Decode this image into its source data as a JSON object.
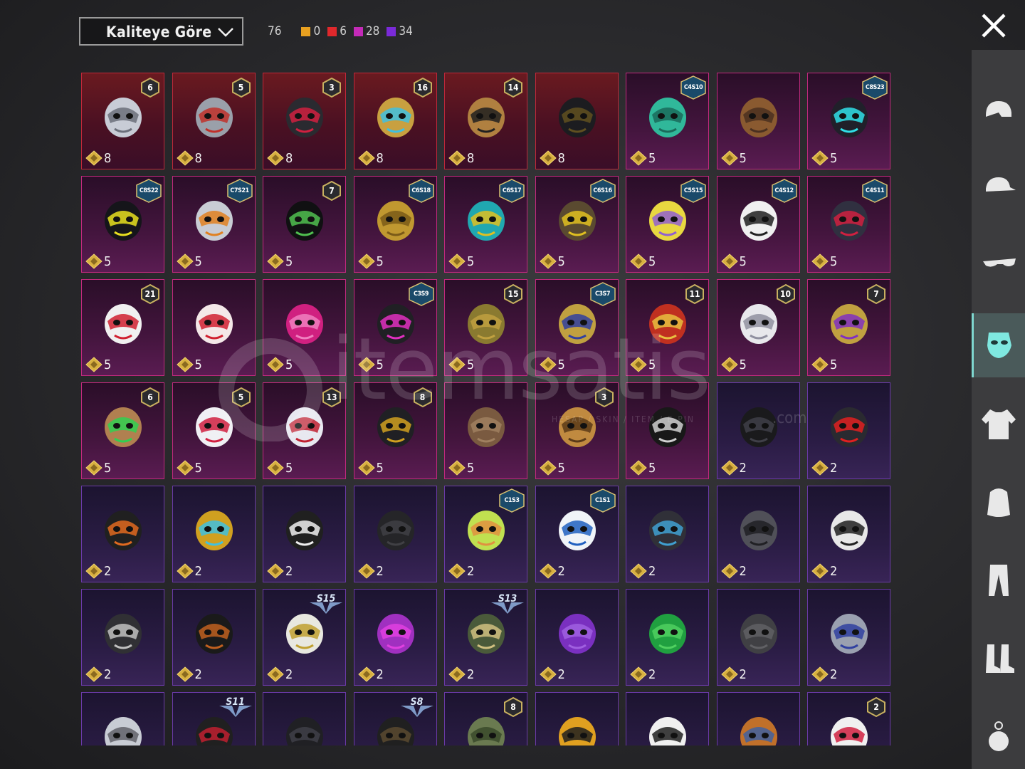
{
  "filter": {
    "sort_label": "Kaliteye Göre"
  },
  "counts": {
    "total": "76",
    "items": [
      {
        "value": "0",
        "color": "#e8a020",
        "name": "legendary"
      },
      {
        "value": "6",
        "color": "#e0282c",
        "name": "mythic"
      },
      {
        "value": "28",
        "color": "#c42ab8",
        "name": "epic"
      },
      {
        "value": "34",
        "color": "#7a2ad8",
        "name": "rare"
      }
    ]
  },
  "watermark": {
    "text": "itemsatis",
    "sub": "HESAP / SKIN / ITEM / E-PIN",
    "tld": ".com"
  },
  "sidebar": {
    "items": [
      {
        "icon": "helmet-icon"
      },
      {
        "icon": "cap-icon"
      },
      {
        "icon": "glasses-icon"
      },
      {
        "icon": "mask-icon",
        "active": true
      },
      {
        "icon": "jacket-icon"
      },
      {
        "icon": "backpack-icon"
      },
      {
        "icon": "pants-icon"
      },
      {
        "icon": "boots-icon"
      },
      {
        "icon": "accessory-icon"
      }
    ]
  },
  "items": [
    {
      "quality": "red",
      "points": "8",
      "badge": {
        "type": "level",
        "text": "6"
      },
      "art": "plague-mask"
    },
    {
      "quality": "red",
      "points": "8",
      "badge": {
        "type": "level",
        "text": "5"
      },
      "art": "tech-visor"
    },
    {
      "quality": "red",
      "points": "8",
      "badge": {
        "type": "level",
        "text": "3"
      },
      "art": "wolf-head"
    },
    {
      "quality": "red",
      "points": "8",
      "badge": {
        "type": "level",
        "text": "16"
      },
      "art": "gold-helm"
    },
    {
      "quality": "red",
      "points": "8",
      "badge": {
        "type": "level",
        "text": "14"
      },
      "art": "half-mask"
    },
    {
      "quality": "red",
      "points": "8",
      "badge": {
        "type": "none",
        "text": ""
      },
      "art": "dark-helm"
    },
    {
      "quality": "pink",
      "points": "5",
      "badge": {
        "type": "season",
        "text": "C4S10"
      },
      "art": "green-mask"
    },
    {
      "quality": "pink",
      "points": "5",
      "badge": {
        "type": "none",
        "text": ""
      },
      "art": "bandana"
    },
    {
      "quality": "pink",
      "points": "5",
      "badge": {
        "type": "season",
        "text": "C8S23"
      },
      "art": "cyan-mask"
    },
    {
      "quality": "pink",
      "points": "5",
      "badge": {
        "type": "season",
        "text": "C8S22"
      },
      "art": "black-mask"
    },
    {
      "quality": "pink",
      "points": "5",
      "badge": {
        "type": "season",
        "text": "C7S21"
      },
      "art": "robot-mask"
    },
    {
      "quality": "pink",
      "points": "5",
      "badge": {
        "type": "level",
        "text": "7"
      },
      "art": "earpiece"
    },
    {
      "quality": "pink",
      "points": "5",
      "badge": {
        "type": "season",
        "text": "C6S18"
      },
      "art": "gold-claw"
    },
    {
      "quality": "pink",
      "points": "5",
      "badge": {
        "type": "season",
        "text": "C6S17"
      },
      "art": "graffiti-mask"
    },
    {
      "quality": "pink",
      "points": "5",
      "badge": {
        "type": "season",
        "text": "C6S16"
      },
      "art": "gas-mask"
    },
    {
      "quality": "pink",
      "points": "5",
      "badge": {
        "type": "season",
        "text": "C5S15"
      },
      "art": "yellow-respirator"
    },
    {
      "quality": "pink",
      "points": "5",
      "badge": {
        "type": "season",
        "text": "C4S12"
      },
      "art": "white-teeth"
    },
    {
      "quality": "pink",
      "points": "5",
      "badge": {
        "type": "season",
        "text": "C4S11"
      },
      "art": "red-tech"
    },
    {
      "quality": "pink",
      "points": "5",
      "badge": {
        "type": "level",
        "text": "21"
      },
      "art": "joker-mask"
    },
    {
      "quality": "pink",
      "points": "5",
      "badge": {
        "type": "none",
        "text": ""
      },
      "art": "fox-mask"
    },
    {
      "quality": "pink",
      "points": "5",
      "badge": {
        "type": "none",
        "text": ""
      },
      "art": "pink-visor"
    },
    {
      "quality": "pink",
      "points": "5",
      "badge": {
        "type": "season",
        "text": "C3S9"
      },
      "art": "neon-respirator"
    },
    {
      "quality": "pink",
      "points": "5",
      "badge": {
        "type": "level",
        "text": "15"
      },
      "art": "cat-mask"
    },
    {
      "quality": "pink",
      "points": "5",
      "badge": {
        "type": "season",
        "text": "C3S7"
      },
      "art": "chain-mask"
    },
    {
      "quality": "pink",
      "points": "5",
      "badge": {
        "type": "level",
        "text": "11"
      },
      "art": "oni-mask"
    },
    {
      "quality": "pink",
      "points": "5",
      "badge": {
        "type": "level",
        "text": "10"
      },
      "art": "white-respirator"
    },
    {
      "quality": "pink",
      "points": "5",
      "badge": {
        "type": "level",
        "text": "7"
      },
      "art": "gold-purple-mask"
    },
    {
      "quality": "pink",
      "points": "5",
      "badge": {
        "type": "level",
        "text": "6"
      },
      "art": "tiki-glasses"
    },
    {
      "quality": "pink",
      "points": "5",
      "badge": {
        "type": "level",
        "text": "5"
      },
      "art": "clown-mask"
    },
    {
      "quality": "pink",
      "points": "5",
      "badge": {
        "type": "level",
        "text": "13"
      },
      "art": "crystal-mask"
    },
    {
      "quality": "pink",
      "points": "5",
      "badge": {
        "type": "level",
        "text": "8"
      },
      "art": "bee-helm"
    },
    {
      "quality": "pink",
      "points": "5",
      "badge": {
        "type": "none",
        "text": ""
      },
      "art": "bird-mask"
    },
    {
      "quality": "pink",
      "points": "5",
      "badge": {
        "type": "level",
        "text": "3"
      },
      "art": "gold-skull"
    },
    {
      "quality": "pink",
      "points": "5",
      "badge": {
        "type": "none",
        "text": ""
      },
      "art": "skull-bandana"
    },
    {
      "quality": "purple",
      "points": "2",
      "badge": {
        "type": "none",
        "text": ""
      },
      "art": "black-half"
    },
    {
      "quality": "purple",
      "points": "2",
      "badge": {
        "type": "none",
        "text": ""
      },
      "art": "red-scope"
    },
    {
      "quality": "purple",
      "points": "2",
      "badge": {
        "type": "none",
        "text": ""
      },
      "art": "orange-strap"
    },
    {
      "quality": "purple",
      "points": "2",
      "badge": {
        "type": "none",
        "text": ""
      },
      "art": "yellow-bot"
    },
    {
      "quality": "purple",
      "points": "2",
      "badge": {
        "type": "none",
        "text": ""
      },
      "art": "teeth-cloth"
    },
    {
      "quality": "purple",
      "points": "2",
      "badge": {
        "type": "none",
        "text": ""
      },
      "art": "black-cloth"
    },
    {
      "quality": "purple",
      "points": "2",
      "badge": {
        "type": "season",
        "text": "C1S3"
      },
      "art": "cactus-bandana"
    },
    {
      "quality": "purple",
      "points": "2",
      "badge": {
        "type": "season",
        "text": "C1S1"
      },
      "art": "blue-white"
    },
    {
      "quality": "purple",
      "points": "2",
      "badge": {
        "type": "none",
        "text": ""
      },
      "art": "blue-mech"
    },
    {
      "quality": "purple",
      "points": "2",
      "badge": {
        "type": "none",
        "text": ""
      },
      "art": "steampunk"
    },
    {
      "quality": "purple",
      "points": "2",
      "badge": {
        "type": "none",
        "text": ""
      },
      "art": "white-skull"
    },
    {
      "quality": "purple",
      "points": "2",
      "badge": {
        "type": "none",
        "text": ""
      },
      "art": "skull-cloth"
    },
    {
      "quality": "purple",
      "points": "2",
      "badge": {
        "type": "none",
        "text": ""
      },
      "art": "dark-bandana"
    },
    {
      "quality": "purple",
      "points": "2",
      "badge": {
        "type": "wing",
        "text": "S15"
      },
      "art": "horned-skull"
    },
    {
      "quality": "purple",
      "points": "2",
      "badge": {
        "type": "none",
        "text": ""
      },
      "art": "purple-gas"
    },
    {
      "quality": "purple",
      "points": "2",
      "badge": {
        "type": "wing",
        "text": "S13"
      },
      "art": "goggles-helm"
    },
    {
      "quality": "purple",
      "points": "2",
      "badge": {
        "type": "none",
        "text": ""
      },
      "art": "purple-gaiter"
    },
    {
      "quality": "purple",
      "points": "2",
      "badge": {
        "type": "none",
        "text": ""
      },
      "art": "green-gaiter"
    },
    {
      "quality": "purple",
      "points": "2",
      "badge": {
        "type": "none",
        "text": ""
      },
      "art": "gray-gaiter"
    },
    {
      "quality": "purple",
      "points": "2",
      "badge": {
        "type": "none",
        "text": ""
      },
      "art": "chrome-visor"
    },
    {
      "quality": "purple",
      "points": "",
      "badge": {
        "type": "none",
        "text": ""
      },
      "art": "silver-mask"
    },
    {
      "quality": "purple",
      "points": "",
      "badge": {
        "type": "wing",
        "text": "S11"
      },
      "art": "red-black"
    },
    {
      "quality": "purple",
      "points": "",
      "badge": {
        "type": "none",
        "text": ""
      },
      "art": "hood"
    },
    {
      "quality": "purple",
      "points": "",
      "badge": {
        "type": "wing",
        "text": "S8"
      },
      "art": "hood-2"
    },
    {
      "quality": "purple",
      "points": "",
      "badge": {
        "type": "level",
        "text": "8"
      },
      "art": "camo-mask"
    },
    {
      "quality": "purple",
      "points": "",
      "badge": {
        "type": "none",
        "text": ""
      },
      "art": "yellow-cloth"
    },
    {
      "quality": "purple",
      "points": "",
      "badge": {
        "type": "none",
        "text": ""
      },
      "art": "white-cloth"
    },
    {
      "quality": "purple",
      "points": "",
      "badge": {
        "type": "none",
        "text": ""
      },
      "art": "cracked-egg"
    },
    {
      "quality": "purple",
      "points": "",
      "badge": {
        "type": "level",
        "text": "2"
      },
      "art": "clown-2"
    }
  ]
}
